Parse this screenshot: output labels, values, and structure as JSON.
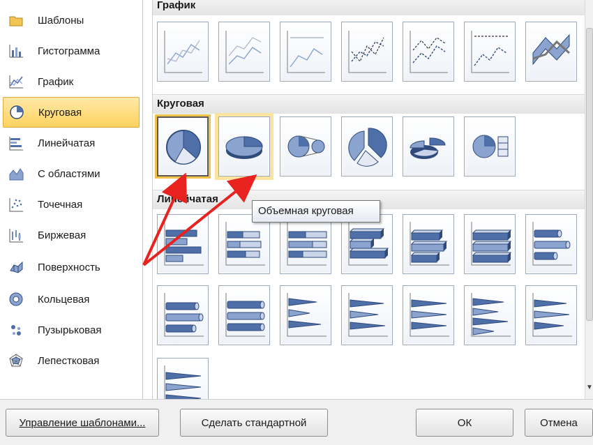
{
  "sidebar": {
    "items": [
      {
        "label": "Шаблоны",
        "icon": "folder-icon",
        "selected": false
      },
      {
        "label": "Гистограмма",
        "icon": "column-chart-icon",
        "selected": false
      },
      {
        "label": "График",
        "icon": "line-chart-icon",
        "selected": false
      },
      {
        "label": "Круговая",
        "icon": "pie-chart-icon",
        "selected": true
      },
      {
        "label": "Линейчатая",
        "icon": "bar-chart-icon",
        "selected": false
      },
      {
        "label": "С областями",
        "icon": "area-chart-icon",
        "selected": false
      },
      {
        "label": "Точечная",
        "icon": "scatter-chart-icon",
        "selected": false
      },
      {
        "label": "Биржевая",
        "icon": "stock-chart-icon",
        "selected": false
      },
      {
        "label": "Поверхность",
        "icon": "surface-chart-icon",
        "selected": false
      },
      {
        "label": "Кольцевая",
        "icon": "doughnut-chart-icon",
        "selected": false
      },
      {
        "label": "Пузырьковая",
        "icon": "bubble-chart-icon",
        "selected": false
      },
      {
        "label": "Лепестковая",
        "icon": "radar-chart-icon",
        "selected": false
      }
    ]
  },
  "gallery": {
    "sections": [
      {
        "title": "График",
        "thumbs": [
          "line-icon",
          "stacked-line-icon",
          "100-stacked-line-icon",
          "line-markers-icon",
          "stacked-line-markers-icon",
          "100-stacked-line-markers-icon",
          "3d-line-icon"
        ]
      },
      {
        "title": "Круговая",
        "thumbs": [
          "pie-icon",
          "3d-pie-icon",
          "pie-of-pie-icon",
          "exploded-pie-icon",
          "exploded-3d-pie-icon",
          "bar-of-pie-icon"
        ]
      },
      {
        "title": "Линейчатая",
        "thumbs": [
          "clustered-bar-icon",
          "stacked-bar-icon",
          "100-stacked-bar-icon",
          "3d-clustered-bar-icon",
          "3d-stacked-bar-icon",
          "3d-100-stacked-bar-icon",
          "clustered-cylinder-bar-icon",
          "stacked-cylinder-bar-icon",
          "100-stacked-cylinder-bar-icon",
          "clustered-cone-bar-icon",
          "stacked-cone-bar-icon",
          "100-stacked-cone-bar-icon",
          "clustered-pyramid-bar-icon",
          "stacked-pyramid-bar-icon",
          "100-stacked-pyramid-bar-icon"
        ]
      }
    ]
  },
  "tooltip": {
    "text": "Объемная круговая"
  },
  "buttons": {
    "manage_templates": "Управление шаблонами...",
    "set_default": "Сделать стандартной",
    "ok": "ОК",
    "cancel": "Отмена"
  },
  "colors": {
    "accent_selected": "#ffd25e",
    "arrow": "#e8231f",
    "chart_blue": "#4f6fa8"
  }
}
